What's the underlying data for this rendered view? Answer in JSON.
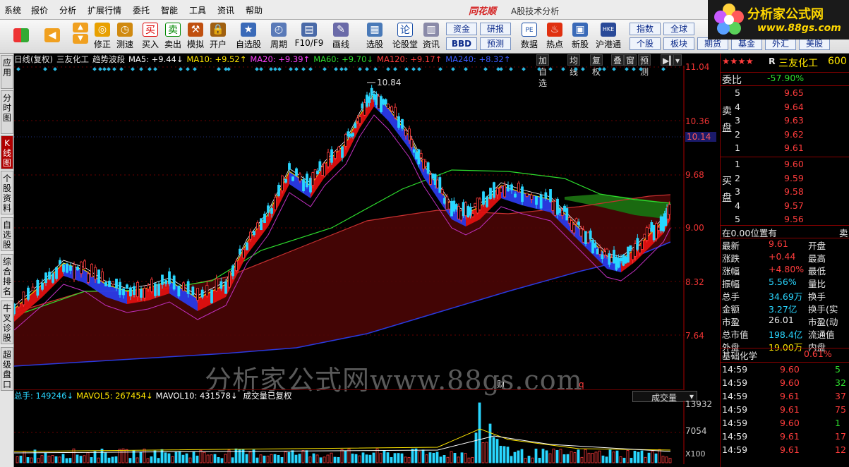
{
  "menu": [
    "系统",
    "报价",
    "分析",
    "扩展行情",
    "委托",
    "智能",
    "工具",
    "资讯",
    "帮助"
  ],
  "brand": "同花顺",
  "window_title": "A股技术分析",
  "logo": {
    "text": "分析家公式网",
    "url": "www.88gs.com"
  },
  "toolbar": {
    "buttons": [
      "修正",
      "测速",
      "买入",
      "卖出",
      "模拟",
      "开户",
      "自选股",
      "周期",
      "F10/F9",
      "画线",
      "选股",
      "论股堂",
      "资讯",
      "数据",
      "热点",
      "新股",
      "沪港通"
    ],
    "small": {
      "zijin": "资金",
      "yanbao": "研报",
      "bbd": "BBD",
      "yuce": "预测",
      "zhishu": "指数",
      "quanqiu": "全球",
      "gegu": "个股",
      "bankuai": "板块",
      "qihuo": "期货",
      "jijin": "基金",
      "waihui": "外汇",
      "meigu": "美股"
    }
  },
  "left_nav": [
    "应用",
    "分时图",
    "K线图",
    "个股资料",
    "自选股",
    "综合排名",
    "牛叉诊股",
    "超级盘口"
  ],
  "chart_header": {
    "period": "日线(复权)",
    "name": "三友化工",
    "indicator": "趋势波段",
    "ma": [
      {
        "label": "MA5: +9.44↓",
        "color": "#ffffff"
      },
      {
        "label": "MA10: +9.52↑",
        "color": "#ffe600"
      },
      {
        "label": "MA20: +9.39↑",
        "color": "#ff40ff"
      },
      {
        "label": "MA60: +9.70↓",
        "color": "#2ddc2d"
      },
      {
        "label": "MA120: +9.17↑",
        "color": "#ff3c3c"
      },
      {
        "label": "MA240: +8.32↑",
        "color": "#3b5bff"
      }
    ],
    "buttons": [
      "加自选",
      "均线",
      "复权",
      "叠",
      "窗",
      "预测"
    ]
  },
  "y_axis": {
    "labels": [
      "11.04",
      "10.36",
      "10.14",
      "9.68",
      "9.00",
      "8.32",
      "7.64"
    ]
  },
  "peak_label": "10.84",
  "markers": {
    "cai": "财",
    "q": "q"
  },
  "watermark": "分析家公式网www.88gs.com",
  "volume": {
    "header": [
      {
        "label": "总手: 149246↓",
        "color": "#29d6ff"
      },
      {
        "label": "MAVOL5: 267454↓",
        "color": "#ffe600"
      },
      {
        "label": "MAVOL10: 431578↓",
        "color": "#ffffff"
      },
      {
        "label": "成交量已复权",
        "color": "#ffffff"
      }
    ],
    "select": "成交量",
    "axis": [
      "13932",
      "7054",
      "X100"
    ]
  },
  "right_panel": {
    "stars": "★★★★",
    "r": "R",
    "name": "三友化工",
    "code": "600",
    "weibi_label": "委比",
    "weibi": "-57.90%",
    "sell_label": "卖盘",
    "buy_label": "买盘",
    "asks": [
      {
        "lvl": "5",
        "price": "9.65"
      },
      {
        "lvl": "4",
        "price": "9.64"
      },
      {
        "lvl": "3",
        "price": "9.63"
      },
      {
        "lvl": "2",
        "price": "9.62"
      },
      {
        "lvl": "1",
        "price": "9.61"
      }
    ],
    "bids": [
      {
        "lvl": "1",
        "price": "9.60"
      },
      {
        "lvl": "2",
        "price": "9.59"
      },
      {
        "lvl": "3",
        "price": "9.58"
      },
      {
        "lvl": "4",
        "price": "9.57"
      },
      {
        "lvl": "5",
        "price": "9.56"
      }
    ],
    "position": "在0.00位置有",
    "position_right": "卖",
    "stats": [
      {
        "l": "最新",
        "v": "9.61",
        "r": "开盘",
        "c": "#ff3c3c"
      },
      {
        "l": "涨跌",
        "v": "+0.44",
        "r": "最高",
        "c": "#ff3c3c"
      },
      {
        "l": "涨幅",
        "v": "+4.80%",
        "r": "最低",
        "c": "#ff3c3c"
      },
      {
        "l": "振幅",
        "v": "5.56%",
        "r": "量比",
        "c": "#29d6ff"
      },
      {
        "l": "总手",
        "v": "34.69万",
        "r": "换手",
        "c": "#29d6ff"
      },
      {
        "l": "金额",
        "v": "3.27亿",
        "r": "换手(实",
        "c": "#29d6ff"
      },
      {
        "l": "市盈",
        "v": "26.01",
        "r": "市盈(动",
        "c": "#e8e8e8"
      },
      {
        "l": "总市值",
        "v": "198.4亿",
        "r": "流通值",
        "c": "#29d6ff"
      },
      {
        "l": "外盘",
        "v": "19.00万",
        "r": "内盘",
        "c": "#ffe600"
      }
    ],
    "sector": "基础化学",
    "sector_pct": "0.61%",
    "ticks": [
      {
        "t": "14:59",
        "p": "9.60",
        "v": "5",
        "pc": "#ff3c3c",
        "vc": "#2ddc2d"
      },
      {
        "t": "14:59",
        "p": "9.60",
        "v": "32",
        "pc": "#ff3c3c",
        "vc": "#2ddc2d"
      },
      {
        "t": "14:59",
        "p": "9.61",
        "v": "37",
        "pc": "#ff3c3c",
        "vc": "#ff3c3c"
      },
      {
        "t": "14:59",
        "p": "9.61",
        "v": "75",
        "pc": "#ff3c3c",
        "vc": "#ff3c3c"
      },
      {
        "t": "14:59",
        "p": "9.60",
        "v": "1",
        "pc": "#ff3c3c",
        "vc": "#2ddc2d"
      },
      {
        "t": "14:59",
        "p": "9.61",
        "v": "17",
        "pc": "#ff3c3c",
        "vc": "#ff3c3c"
      },
      {
        "t": "14:59",
        "p": "9.61",
        "v": "12",
        "pc": "#ff3c3c",
        "vc": "#ff3c3c"
      }
    ]
  }
}
